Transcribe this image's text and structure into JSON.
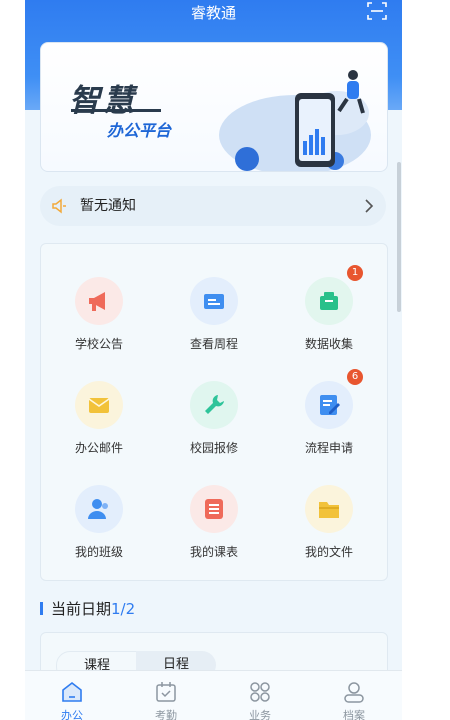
{
  "app": {
    "title": "睿教通"
  },
  "banner": {
    "line1": "智慧",
    "line2": "办公平台"
  },
  "notice": {
    "text": "暂无通知"
  },
  "grid": {
    "items": [
      {
        "label": "学校公告",
        "icon": "megaphone-icon",
        "color": "#ef6a5a",
        "bg": "#fbe9e7"
      },
      {
        "label": "查看周程",
        "icon": "calendar-card-icon",
        "color": "#3f8ef0",
        "bg": "#e3eefc"
      },
      {
        "label": "数据收集",
        "icon": "folder-box-icon",
        "color": "#29c08a",
        "bg": "#e2f6ee",
        "badge": "1"
      },
      {
        "label": "办公邮件",
        "icon": "mail-icon",
        "color": "#f2c23a",
        "bg": "#fbf4dc"
      },
      {
        "label": "校园报修",
        "icon": "wrench-icon",
        "color": "#2ec49a",
        "bg": "#e0f6ef"
      },
      {
        "label": "流程申请",
        "icon": "edit-doc-icon",
        "color": "#3f8ef0",
        "bg": "#e3eefc",
        "badge": "6"
      },
      {
        "label": "我的班级",
        "icon": "people-icon",
        "color": "#3f8ef0",
        "bg": "#e3eefc"
      },
      {
        "label": "我的课表",
        "icon": "list-icon",
        "color": "#ef6a5a",
        "bg": "#fbe9e7"
      },
      {
        "label": "我的文件",
        "icon": "folder-icon",
        "color": "#f2c23a",
        "bg": "#fbf4dc"
      }
    ]
  },
  "date_section": {
    "label": "当前日期",
    "page": "1/2"
  },
  "schedule": {
    "tabs": [
      "课程",
      "日程"
    ]
  },
  "tabbar": {
    "items": [
      {
        "label": "办公",
        "icon": "home-icon",
        "active": true
      },
      {
        "label": "考勤",
        "icon": "calendar-check-icon",
        "active": false
      },
      {
        "label": "业务",
        "icon": "apps-grid-icon",
        "active": false
      },
      {
        "label": "档案",
        "icon": "profile-icon",
        "active": false
      }
    ]
  },
  "colors": {
    "primary": "#2f7cf0",
    "badge": "#e8562f"
  }
}
